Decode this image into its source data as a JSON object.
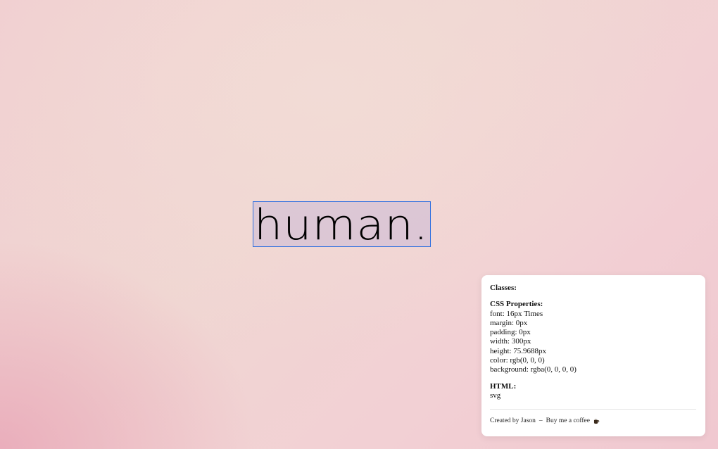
{
  "hero": {
    "word": "human."
  },
  "inspector": {
    "classes_label": "Classes:",
    "css_label": "CSS Properties:",
    "css_properties": [
      "font: 16px Times",
      "margin: 0px",
      "padding: 0px",
      "width: 300px",
      "height: 75.9688px",
      "color: rgb(0, 0, 0)",
      "background: rgba(0, 0, 0, 0)"
    ],
    "html_label": "HTML:",
    "html_tag": "svg",
    "footer": {
      "created_by": "Created by Jason",
      "separator": "–",
      "coffee_link": "Buy me a coffee"
    }
  },
  "colors": {
    "selection_border": "#2f6fe0",
    "panel_bg": "#ffffff"
  }
}
